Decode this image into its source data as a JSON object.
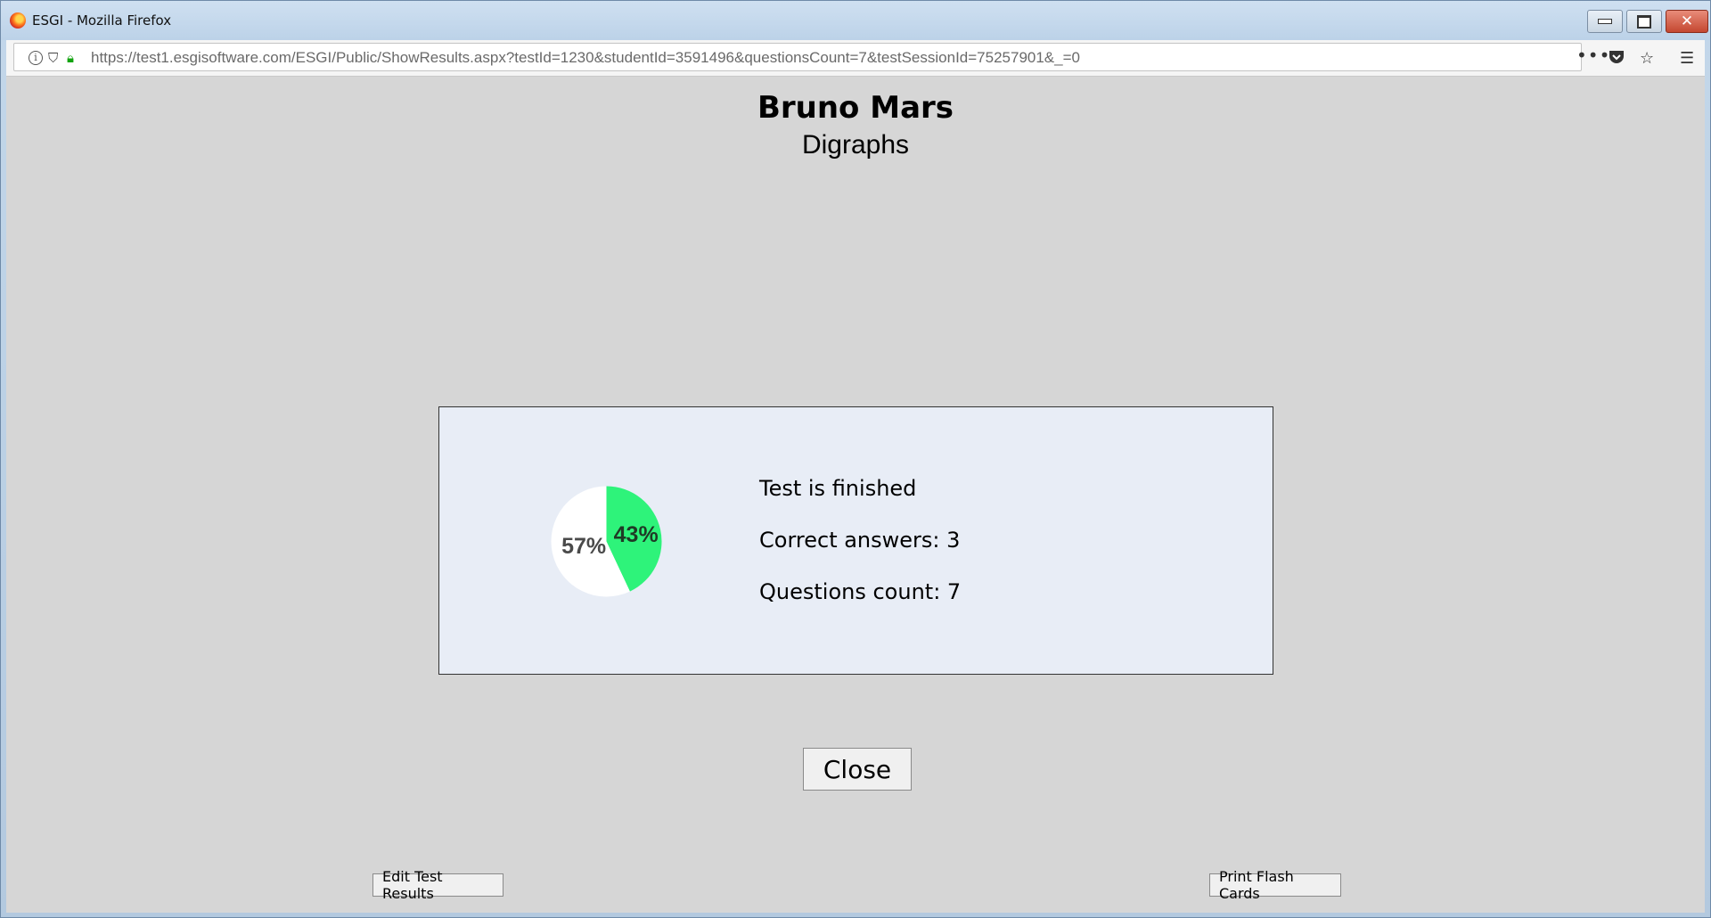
{
  "window": {
    "title": "ESGI - Mozilla Firefox"
  },
  "browser": {
    "url": "https://test1.esgisoftware.com/ESGI/Public/ShowResults.aspx?testId=1230&studentId=3591496&questionsCount=7&testSessionId=75257901&_=0",
    "icons": [
      "info-icon",
      "shield-icon",
      "lock-icon",
      "more-icon",
      "pocket-icon",
      "bookmark-star-icon",
      "menu-icon"
    ]
  },
  "header": {
    "student_name": "Bruno Mars",
    "test_name": "Digraphs"
  },
  "results": {
    "status": "Test is finished",
    "correct_answers": "Correct answers: 3",
    "questions_count": "Questions count: 7"
  },
  "chart_data": {
    "type": "pie",
    "slices": [
      {
        "label": "43%",
        "value": 43,
        "color": "#2ef37a"
      },
      {
        "label": "57%",
        "value": 57,
        "color": "#ffffff"
      }
    ]
  },
  "buttons": {
    "close": "Close",
    "edit": "Edit Test Results",
    "print": "Print Flash Cards"
  },
  "colors": {
    "page_bg": "#d6d6d6",
    "panel_bg": "#e8edf6",
    "correct": "#2ef37a"
  }
}
